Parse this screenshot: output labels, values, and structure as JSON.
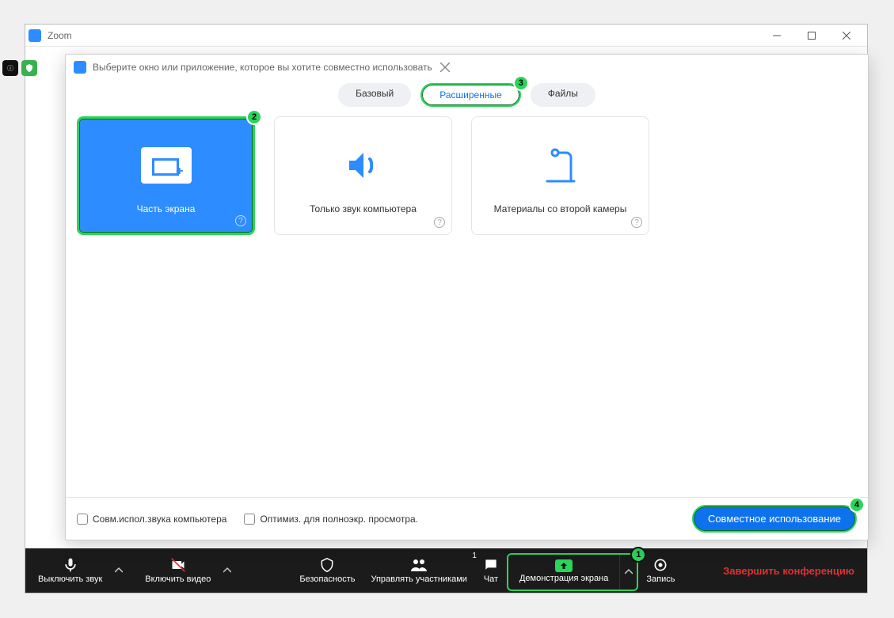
{
  "window": {
    "title": "Zoom"
  },
  "dialog": {
    "title": "Выберите окно или приложение, которое вы хотите совместно использовать",
    "tabs": {
      "basic": "Базовый",
      "advanced": "Расширенные",
      "files": "Файлы"
    },
    "cards": {
      "portion": "Часть экрана",
      "audio_only": "Только звук компьютера",
      "second_camera": "Материалы со второй камеры"
    },
    "footer": {
      "share_audio": "Совм.испол.звука компьютера",
      "optimize": "Оптимиз. для полноэкр. просмотра.",
      "share_btn": "Совместное использование"
    }
  },
  "toolbar": {
    "mute": "Выключить звук",
    "video": "Включить видео",
    "security": "Безопасность",
    "participants": "Управлять участниками",
    "participants_count": "1",
    "chat": "Чат",
    "share": "Демонстрация экрана",
    "record": "Запись",
    "end": "Завершить конференцию"
  },
  "annotations": {
    "1": "1",
    "2": "2",
    "3": "3",
    "4": "4"
  }
}
